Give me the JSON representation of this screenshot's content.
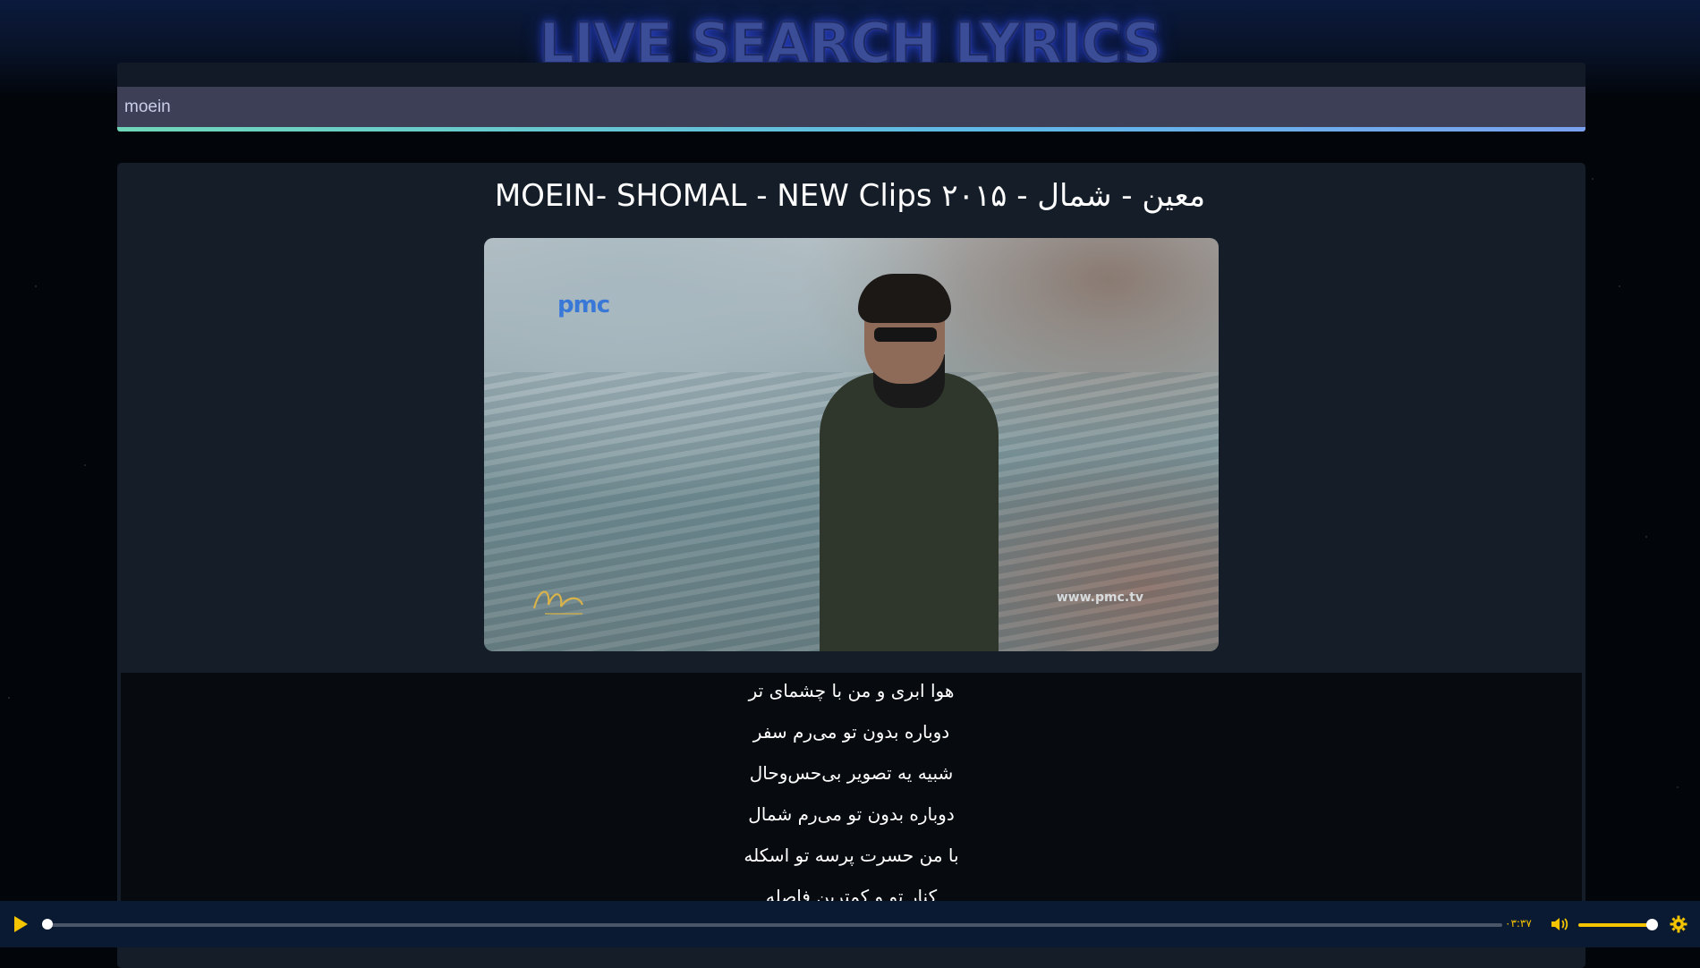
{
  "app": {
    "title": "LIVE SEARCH LYRICS"
  },
  "search": {
    "value": "moein"
  },
  "song": {
    "title": "MOEIN- SHOMAL - NEW Clips ۲۰۱۵ - معین - شمال"
  },
  "video": {
    "channel_logo": "pmc",
    "watermark": "www.pmc.tv",
    "signature_logo_text": "Moein"
  },
  "lyrics": {
    "lines": [
      "هوا ابری و من با چشمای تر",
      "دوباره بدون تو می‌رم سفر",
      "شبیه یه تصویر بی‌حس‌وحال",
      "دوباره بدون تو می‌رم شمال",
      "با من حسرت پرسه تو اسکله",
      "کنار تو و کمترین فاصله"
    ]
  },
  "player": {
    "time": "۰۳:۳۷",
    "progress": 0,
    "volume": 1.0,
    "accent_color": "#f4c400",
    "icons": [
      "play-icon",
      "volume-icon",
      "gear-icon"
    ]
  }
}
